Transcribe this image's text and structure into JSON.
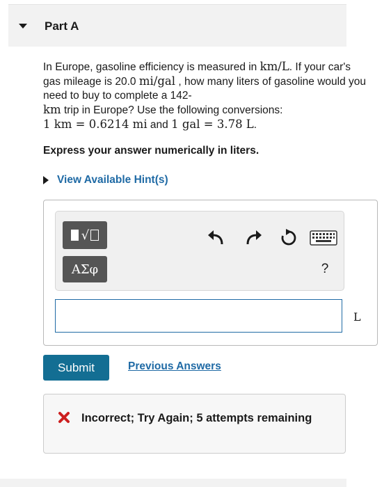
{
  "part": {
    "title": "Part A"
  },
  "question": {
    "t1": "In Europe, gasoline efficiency is measured in ",
    "m1": "km/L",
    "t2": ". If your car's gas mileage is 20.0 ",
    "m2": "mi/gal",
    "t3": " , how many liters of gasoline would you need to buy to complete a 142-",
    "m3": "km",
    "t4": " trip in Europe? Use the following conversions:",
    "m4": "1 km = 0.6214 mi",
    "t5": " and ",
    "m5": "1 gal = 3.78 L",
    "t6": "."
  },
  "instruction": "Express your answer numerically in liters.",
  "hint": {
    "label": "View Available Hint(s)"
  },
  "toolbar": {
    "greek_label": "ΑΣφ",
    "help_label": "?",
    "icons": [
      "templates-icon",
      "undo-icon",
      "redo-icon",
      "reset-icon",
      "keyboard-icon"
    ]
  },
  "answer": {
    "value": "",
    "unit": "L"
  },
  "submit_label": "Submit",
  "previous_answers_label": "Previous Answers",
  "feedback": {
    "text": "Incorrect; Try Again; 5 attempts remaining",
    "icon": "error-x-icon",
    "icon_color": "#cc1f1f"
  },
  "colors": {
    "accent": "#136e93",
    "link": "#1f6aa5"
  }
}
